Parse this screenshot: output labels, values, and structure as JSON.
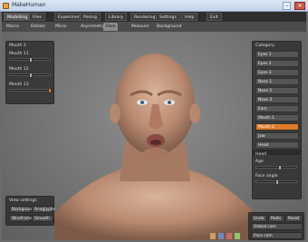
{
  "window": {
    "title": "MakeHuman",
    "minimize_glyph": "–",
    "close_glyph": "✕"
  },
  "main_tabs": [
    "Modelling",
    "Files",
    "Experiments",
    "Posing",
    "Library",
    "Rendering",
    "Settings",
    "Help",
    "Exit"
  ],
  "sub_tabs": [
    "Macro",
    "Details",
    "Micro",
    "Asymmetry",
    "Face",
    "Measure",
    "Background"
  ],
  "mouth_panel": {
    "title": "Mouth 2",
    "sliders": [
      {
        "label": "Mouth 11",
        "value": 0.5
      },
      {
        "label": "Mouth 12",
        "value": 0.5
      },
      {
        "label": "Mouth 13",
        "value": 1.0
      }
    ]
  },
  "category_panel": {
    "title": "Category",
    "items": [
      "Eyes 1",
      "Eyes 2",
      "Eyes 3",
      "Nose 1",
      "Nose 2",
      "Nose 3",
      "Ears",
      "Mouth 1",
      "Mouth 2",
      "Jaw",
      "Head"
    ],
    "selected": "Mouth 2"
  },
  "head_panel": {
    "title": "Head",
    "sliders": [
      {
        "label": "Age",
        "value": 0.55
      },
      {
        "label": "Face angle",
        "value": 0.5
      }
    ]
  },
  "view_settings": {
    "title": "View settings",
    "buttons": [
      "Background",
      "Anaglyphs",
      "Wireframe",
      "Smooth"
    ]
  },
  "history": {
    "undo": "Undo",
    "redo": "Redo",
    "reset": "Reset"
  },
  "camera": {
    "global": "Global cam",
    "face": "Face cam"
  },
  "colors": {
    "accent": "#e07a26",
    "panel": "#2c2c2c",
    "viewport": "#7a7a7a"
  }
}
